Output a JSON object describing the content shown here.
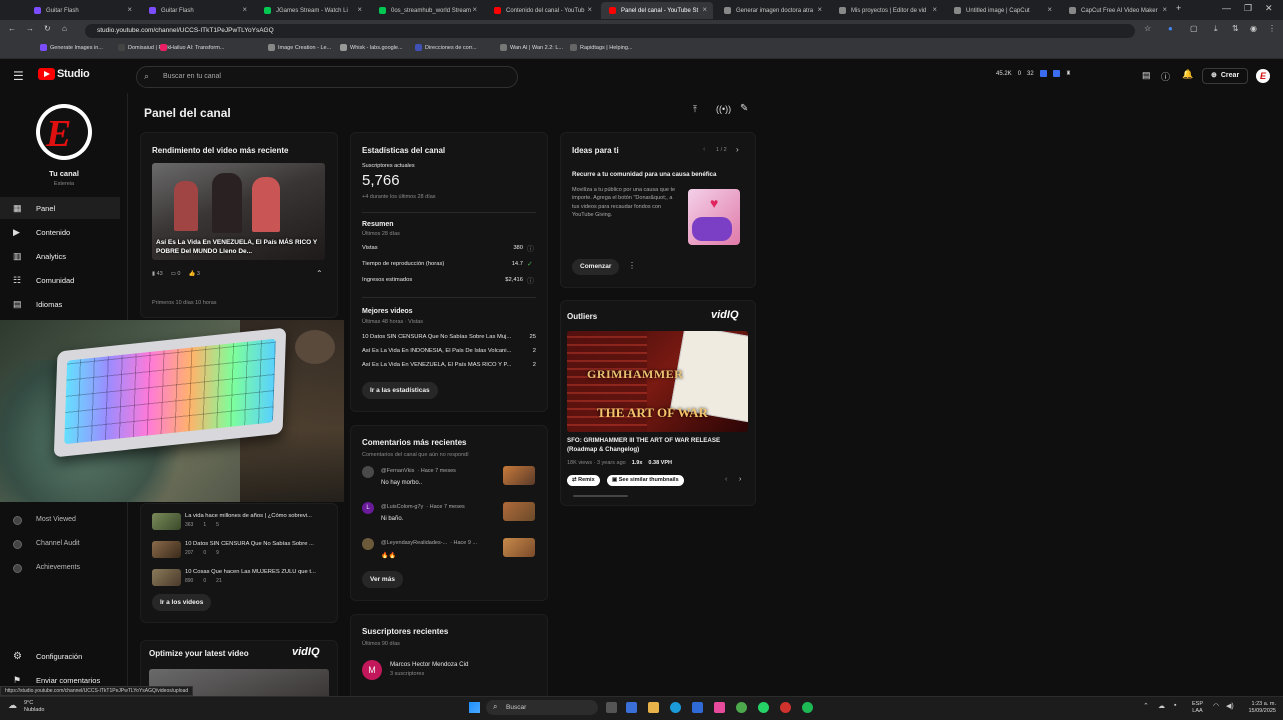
{
  "browser": {
    "tabs": [
      {
        "label": "Guitar Flash",
        "color": "#7c4dff"
      },
      {
        "label": "Guitar Flash",
        "color": "#7c4dff"
      },
      {
        "label": "JGames Stream - Watch Li",
        "color": "#00c853"
      },
      {
        "label": "0os_streamhub_world Stream",
        "color": "#00c853"
      },
      {
        "label": "Contenido del canal - YouTub",
        "color": "#ff0000"
      },
      {
        "label": "Panel del canal - YouTube St",
        "color": "#ff0000"
      },
      {
        "label": "Generar imagen doctora atra",
        "color": "#888888"
      },
      {
        "label": "Mis proyectos | Editor de vid",
        "color": "#888888"
      },
      {
        "label": "Untitled image | CapCut",
        "color": "#888888"
      },
      {
        "label": "CapCut Free AI Video Maker",
        "color": "#888888"
      }
    ],
    "url": "studio.youtube.com/channel/UCCS-ITkT1PeJPwTLYoYsAGQ",
    "bookmarks": [
      "Generate Images in...",
      "Domisaiud | Rork",
      "Hailuo AI: Transform...",
      "Image Creation - Le...",
      "Whisk - labs.google...",
      "Direcciones de corr...",
      "Wan AI | Wan 2.2: L...",
      "Rapidtags | Helping..."
    ]
  },
  "studio": {
    "logo": "Studio",
    "search_placeholder": "Buscar en tu canal",
    "stats": {
      "views": "45.2K",
      "zero": "0",
      "count": "32"
    },
    "create_label": "Crear"
  },
  "sidebar": {
    "channel_label": "Tu canal",
    "channel_name": "Estereia",
    "items": [
      {
        "label": "Panel"
      },
      {
        "label": "Contenido"
      },
      {
        "label": "Analytics"
      },
      {
        "label": "Comunidad"
      },
      {
        "label": "Idiomas"
      }
    ],
    "subitems": [
      {
        "label": "Most Viewed"
      },
      {
        "label": "Channel Audit"
      },
      {
        "label": "Achievements"
      }
    ],
    "settings_label": "Configuración",
    "feedback_label": "Enviar comentarios"
  },
  "page": {
    "title": "Panel del canal"
  },
  "latest_video": {
    "heading": "Rendimiento del video más reciente",
    "title": "Así Es La Vida En VENEZUELA, El País MÁS RICO Y POBRE Del MUNDO Lleno De...",
    "views": "43",
    "comments": "0",
    "likes": "3",
    "first_days": "Primeros 10 días 10 horas"
  },
  "video_list": [
    {
      "title": "La vida hace millones de años | ¿Cómo sobrevi...",
      "views": "363",
      "comments": "1",
      "likes": "5"
    },
    {
      "title": "10 Datos SIN CENSURA Que No Sabías Sobre ...",
      "views": "207",
      "comments": "0",
      "likes": "9"
    },
    {
      "title": "10 Cosas Que hacen Las MUJERES ZULU que t...",
      "views": "890",
      "comments": "0",
      "likes": "21"
    }
  ],
  "go_videos": "Ir a los videos",
  "optimize": {
    "heading": "Optimize your latest video",
    "brand": "vidIQ"
  },
  "stats": {
    "heading": "Estadísticas del canal",
    "subs_label": "Suscriptores actuales",
    "subs_value": "5,766",
    "subs_delta": "+4 durante los últimos 28 días",
    "summary_label": "Resumen",
    "summary_period": "Últimos 28 días",
    "rows": [
      {
        "label": "Vistas",
        "value": "380"
      },
      {
        "label": "Tiempo de reproducción (horas)",
        "value": "14.7"
      },
      {
        "label": "Ingresos estimados",
        "value": "$2,416"
      }
    ],
    "best_label": "Mejores videos",
    "best_period": "Últimas 48 horas · Vistas",
    "best": [
      {
        "title": "10 Datos SIN CENSURA Que No Sabías Sobre Las Muj...",
        "value": "25"
      },
      {
        "title": "Así Es La Vida En INDONESIA, El País De Islas Volcani...",
        "value": "2"
      },
      {
        "title": "Así Es La Vida En VENEZUELA, El País MÁS RICO Y P...",
        "value": "2"
      }
    ],
    "go_stats": "Ir a las estadísticas"
  },
  "comments": {
    "heading": "Comentarios más recientes",
    "sub": "Comentarios del canal que aún no respondí",
    "items": [
      {
        "user": "@FernanVkis",
        "time": "· Hace 7 meses",
        "text": "No hay morbo..",
        "initial": ""
      },
      {
        "user": "@LuisColom-g7y",
        "time": "· Hace 7 meses",
        "text": "Ni baño.",
        "initial": "L"
      },
      {
        "user": "@LeyendasyRealidades-...",
        "time": "· Hace 9 ...",
        "text": "🔥🔥",
        "initial": ""
      }
    ],
    "more": "Ver más"
  },
  "subscribers": {
    "heading": "Suscriptores recientes",
    "period": "Últimos 90 días",
    "items": [
      {
        "name": "Marcos Hector Mendoza Cid",
        "subs": "3 suscriptores",
        "initial": "M"
      }
    ]
  },
  "ideas": {
    "heading": "Ideas para ti",
    "pager": "1 / 2",
    "title": "Recurre a tu comunidad para una causa benéfica",
    "body": "Movilíza a tu público por una causa que te importe. Agrega el botón \"Donar&quot;, a tus videos para recaudar fondos con YouTube Giving.",
    "cta": "Comenzar"
  },
  "outliers": {
    "heading": "Outliers",
    "brand": "vidIQ",
    "thumb_title1": "GRIMHAMMER",
    "thumb_title2": "THE ART OF WAR",
    "title": "SFO: GRIMHAMMER III THE ART OF WAR RELEASE (Roadmap & Changelog)",
    "meta": "18K views · 3 years ago",
    "mult": "1.9x",
    "vph": "0.38 VPH",
    "remix": "Remix",
    "similar": "See similar thumbnails"
  },
  "statusbar_url": "https://studio.youtube.com/channel/UCCS-ITkT1PeJPwTLYoYsAGQ/videos/upload",
  "taskbar": {
    "weather_temp": "9°C",
    "weather_desc": "Nublado",
    "search": "Buscar",
    "lang1": "ESP",
    "lang2": "LAA",
    "time": "1:23 a. m.",
    "date": "15/09/2025"
  }
}
